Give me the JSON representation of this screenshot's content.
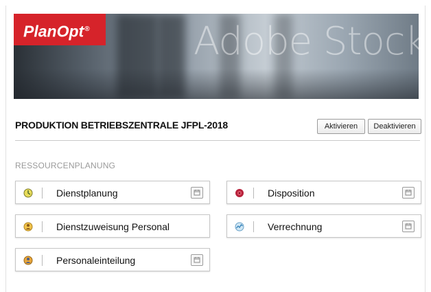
{
  "brand": {
    "logo_text": "PlanOpt",
    "logo_mark": "®",
    "logo_color": "#d6232a"
  },
  "banner": {
    "watermark": "Adobe Stock"
  },
  "header": {
    "title": "PRODUKTION BETRIEBSZENTRALE JFPL-2018",
    "activate_label": "Aktivieren",
    "deactivate_label": "Deaktivieren"
  },
  "section": {
    "label": "RESSOURCENPLANUNG"
  },
  "tiles": [
    {
      "label": "Dienstplanung",
      "icon": "clock-icon",
      "has_calendar": true
    },
    {
      "label": "Disposition",
      "icon": "gear-red-icon",
      "has_calendar": true
    },
    {
      "label": "Dienstzuweisung Personal",
      "icon": "person-gear-icon",
      "has_calendar": false
    },
    {
      "label": "Verrechnung",
      "icon": "chart-icon",
      "has_calendar": true
    },
    {
      "label": "Personaleinteilung",
      "icon": "person-icon",
      "has_calendar": true
    }
  ]
}
